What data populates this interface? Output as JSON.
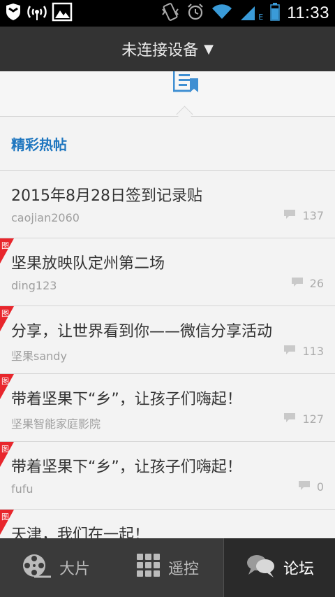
{
  "status_bar": {
    "time": "11:33",
    "network_type": "E",
    "icons": [
      "shield-icon",
      "wifi-hotspot-icon",
      "image-icon",
      "vibrate-icon",
      "alarm-icon",
      "wifi-icon",
      "signal-icon",
      "battery-icon"
    ]
  },
  "header": {
    "title": "未连接设备",
    "caret": "▼"
  },
  "section": {
    "title": "精彩热帖"
  },
  "posts": [
    {
      "title": "2015年8月28日签到记录贴",
      "author": "caojian2060",
      "count": "137",
      "has_image": false
    },
    {
      "title": "坚果放映队定州第二场",
      "author": "ding123",
      "count": "26",
      "has_image": true
    },
    {
      "title": "分享，让世界看到你——微信分享活动",
      "author": "坚果sandy",
      "count": "113",
      "has_image": true
    },
    {
      "title": "带着坚果下“乡”，让孩子们嗨起！",
      "author": "坚果智能家庭影院",
      "count": "127",
      "has_image": true
    },
    {
      "title": "带着坚果下“乡”，让孩子们嗨起！",
      "author": "fufu",
      "count": "0",
      "has_image": true
    },
    {
      "title": "天津，我们在一起！",
      "author": "",
      "count": "",
      "has_image": true
    }
  ],
  "badge_char": "图",
  "nav": {
    "tabs": [
      {
        "label": "大片",
        "icon": "film-reel-icon",
        "active": false
      },
      {
        "label": "遥控",
        "icon": "grid-icon",
        "active": false
      },
      {
        "label": "论坛",
        "icon": "chat-bubbles-icon",
        "active": true
      }
    ]
  },
  "colors": {
    "accent": "#1e76bf",
    "badge_red": "#e8262c",
    "header_bg": "#333333",
    "nav_bg": "#3a3a3a"
  }
}
